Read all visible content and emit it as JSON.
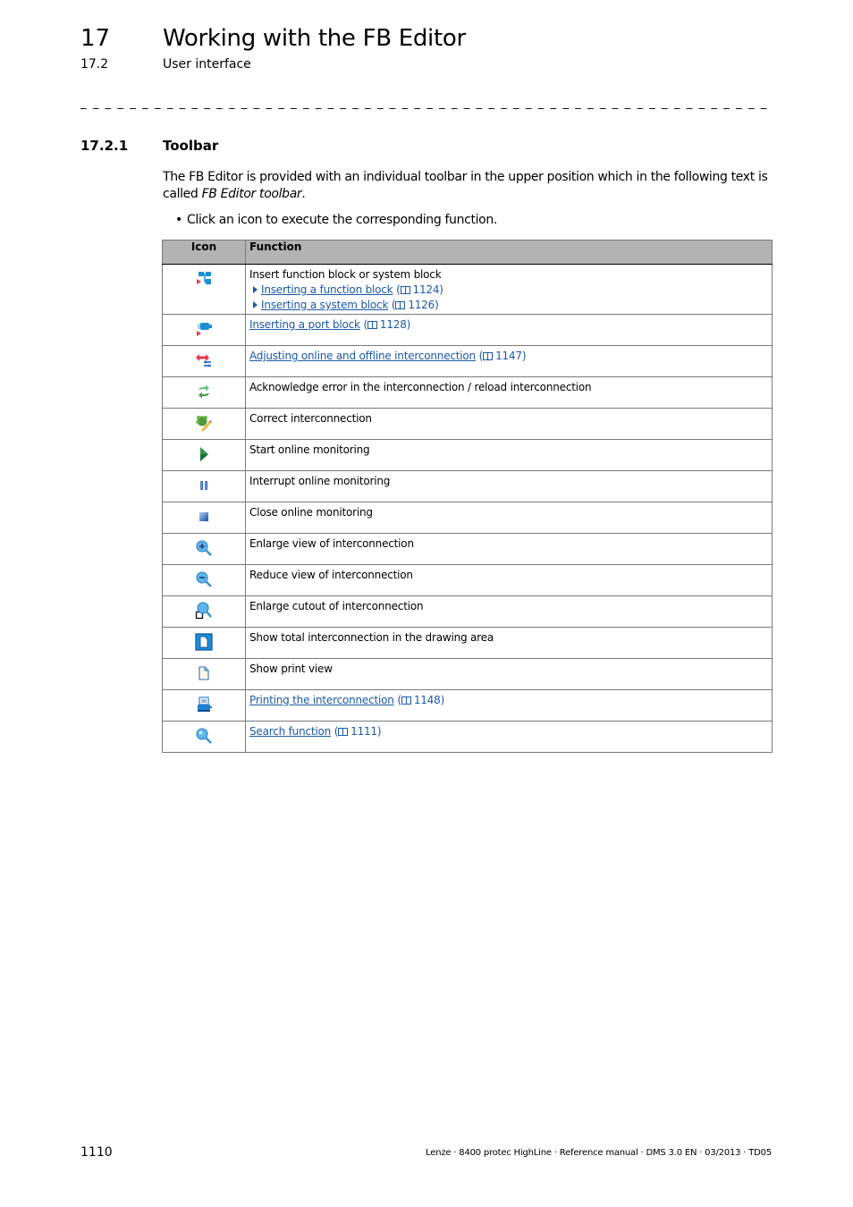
{
  "header": {
    "chapter_number": "17",
    "chapter_title": "Working with the FB Editor",
    "section_number": "17.2",
    "section_title": "User interface",
    "separator": "_ _ _ _ _ _ _ _ _ _ _ _ _ _ _ _ _ _ _ _ _ _ _ _ _ _ _ _ _ _ _ _ _ _ _ _ _ _ _ _ _ _ _ _ _ _ _ _ _ _ _ _ _ _ _ _ _ _ _ _ _ _ _ _ _ _ _ _"
  },
  "subsection": {
    "number": "17.2.1",
    "title": "Toolbar"
  },
  "intro": {
    "text_before": "The FB Editor is provided with an individual toolbar in the upper position which in the following text is called ",
    "emphasis": "FB Editor toolbar",
    "text_after": ".",
    "bullet": "Click an icon to execute the corresponding function."
  },
  "table": {
    "headers": {
      "icon": "Icon",
      "function": "Function"
    },
    "rows": [
      {
        "icon": "insert-block-icon",
        "text": "Insert function block or system block",
        "sublinks": [
          {
            "label": "Inserting a function block",
            "page": "1124"
          },
          {
            "label": "Inserting a system block",
            "page": "1126"
          }
        ]
      },
      {
        "icon": "port-block-icon",
        "link": "Inserting a port block",
        "page": "1128"
      },
      {
        "icon": "adjust-interconnection-icon",
        "link": "Adjusting online and offline interconnection",
        "page": "1147"
      },
      {
        "icon": "reload-icon",
        "text": "Acknowledge error in the interconnection / reload interconnection"
      },
      {
        "icon": "correct-interconnection-icon",
        "text": "Correct interconnection"
      },
      {
        "icon": "play-icon",
        "text": "Start online monitoring"
      },
      {
        "icon": "pause-icon",
        "text": "Interrupt online monitoring"
      },
      {
        "icon": "stop-icon",
        "text": "Close online monitoring"
      },
      {
        "icon": "zoom-in-icon",
        "text": "Enlarge view of interconnection"
      },
      {
        "icon": "zoom-out-icon",
        "text": "Reduce view of interconnection"
      },
      {
        "icon": "zoom-cutout-icon",
        "text": "Enlarge cutout of interconnection"
      },
      {
        "icon": "fit-page-icon",
        "text": "Show total interconnection in the drawing area"
      },
      {
        "icon": "print-view-icon",
        "text": "Show print view"
      },
      {
        "icon": "printer-icon",
        "link": "Printing the interconnection",
        "page": "1148"
      },
      {
        "icon": "search-icon",
        "link": "Search function",
        "page": "1111"
      }
    ]
  },
  "colors": {
    "link": "#1a5aa6",
    "header_bg": "#b3b3b3"
  },
  "footer": {
    "page_number": "1110",
    "doc_info": "Lenze · 8400 protec HighLine · Reference manual · DMS 3.0 EN · 03/2013 · TD05"
  }
}
